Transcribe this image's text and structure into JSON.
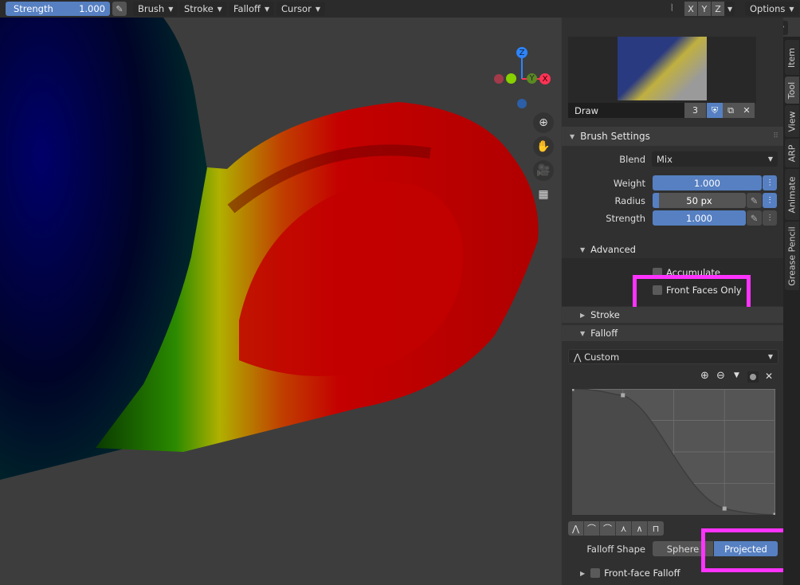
{
  "header": {
    "strength_label": "Strength",
    "strength_value": "1.000",
    "menus": [
      {
        "label": "Brush"
      },
      {
        "label": "Stroke"
      },
      {
        "label": "Falloff"
      },
      {
        "label": "Cursor"
      }
    ],
    "axes": [
      "X",
      "Y",
      "Z"
    ],
    "options_label": "Options"
  },
  "viewport": {
    "gizmo": {
      "z": "Z",
      "y": "Y",
      "x": "X"
    },
    "nav_buttons": [
      "zoom-icon",
      "hand-pan-icon",
      "camera-icon",
      "grid-icon"
    ]
  },
  "brush": {
    "name": "Draw",
    "users": "3"
  },
  "brush_settings": {
    "title": "Brush Settings",
    "blend_label": "Blend",
    "blend_value": "Mix",
    "weight_label": "Weight",
    "weight_value": "1.000",
    "weight_fraction": 1.0,
    "radius_label": "Radius",
    "radius_value": "50 px",
    "strength_label": "Strength",
    "strength_value": "1.000",
    "strength_fraction": 1.0
  },
  "advanced": {
    "title": "Advanced",
    "accumulate": "Accumulate",
    "front_faces_only": "Front Faces Only"
  },
  "stroke": {
    "title": "Stroke"
  },
  "falloff": {
    "title": "Falloff",
    "preset": "Custom",
    "curve_points": [
      [
        0,
        1
      ],
      [
        0.25,
        0.95
      ],
      [
        0.75,
        0.05
      ],
      [
        1,
        0
      ]
    ],
    "shape_label": "Falloff Shape",
    "shape_options": [
      "Sphere",
      "Projected"
    ],
    "shape_selected": "Projected",
    "front_face_falloff": "Front-face Falloff"
  },
  "tabs": [
    "Item",
    "Tool",
    "View",
    "ARP",
    "Animate",
    "Grease Pencil"
  ],
  "active_tab": "Tool",
  "colors": {
    "accent": "#5680c2",
    "highlight": "#ff33ff"
  }
}
